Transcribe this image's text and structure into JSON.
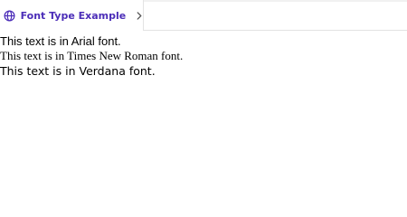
{
  "browser": {
    "tab": {
      "title": "Font Type Example",
      "icon": "globe-icon",
      "chevron": "chevron-right-icon",
      "accent_color": "#4b2db8"
    }
  },
  "page": {
    "lines": [
      {
        "text": "This text is in Arial font."
      },
      {
        "text": "This text is in Times New Roman font."
      },
      {
        "text": "This text is in Verdana font."
      }
    ]
  }
}
